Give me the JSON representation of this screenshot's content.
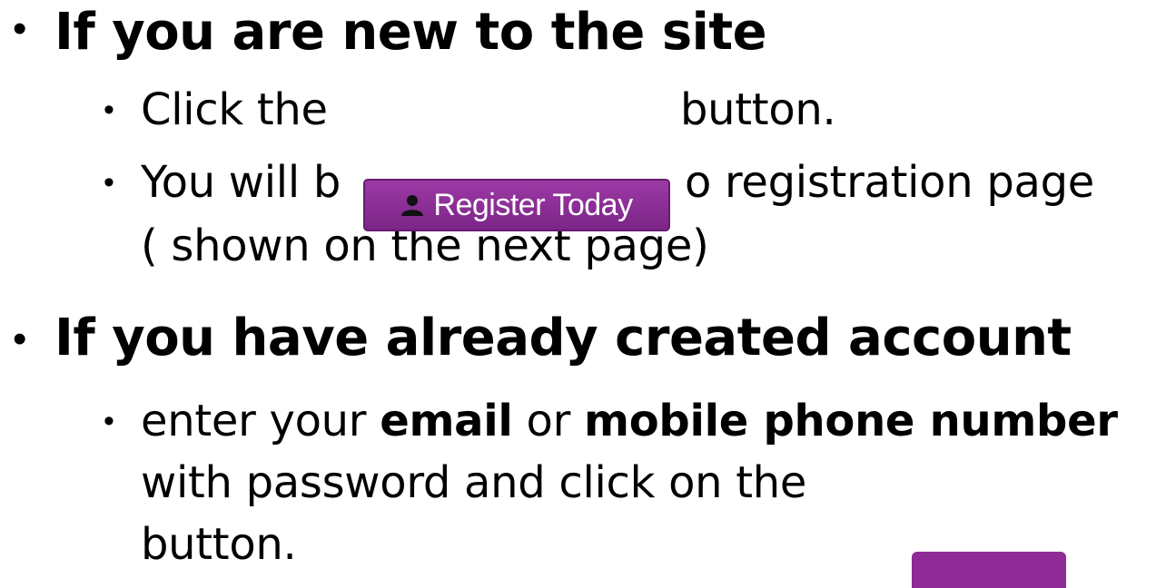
{
  "slide": {
    "section_new": {
      "bullet": "•",
      "heading": "If you are new to the site",
      "items": {
        "click_the": "Click the",
        "button_word": "button.",
        "redirect_part1": "You will b",
        "redirect_part2": "o registration page",
        "redirect_part3": "( shown on the next page)"
      }
    },
    "section_existing": {
      "bullet": "•",
      "heading": "If you have already created account",
      "items": {
        "enter_your": "enter your",
        "email": "email",
        "or": "or",
        "mobile": "mobile phone number",
        "with_password": "with password and click on the",
        "button_word": "button."
      }
    },
    "sub_bullet": "•"
  },
  "register_button": {
    "label": "Register Today",
    "icon": "user-icon",
    "color": "#8e2b96"
  },
  "login_button": {
    "color": "#8e2b96"
  }
}
